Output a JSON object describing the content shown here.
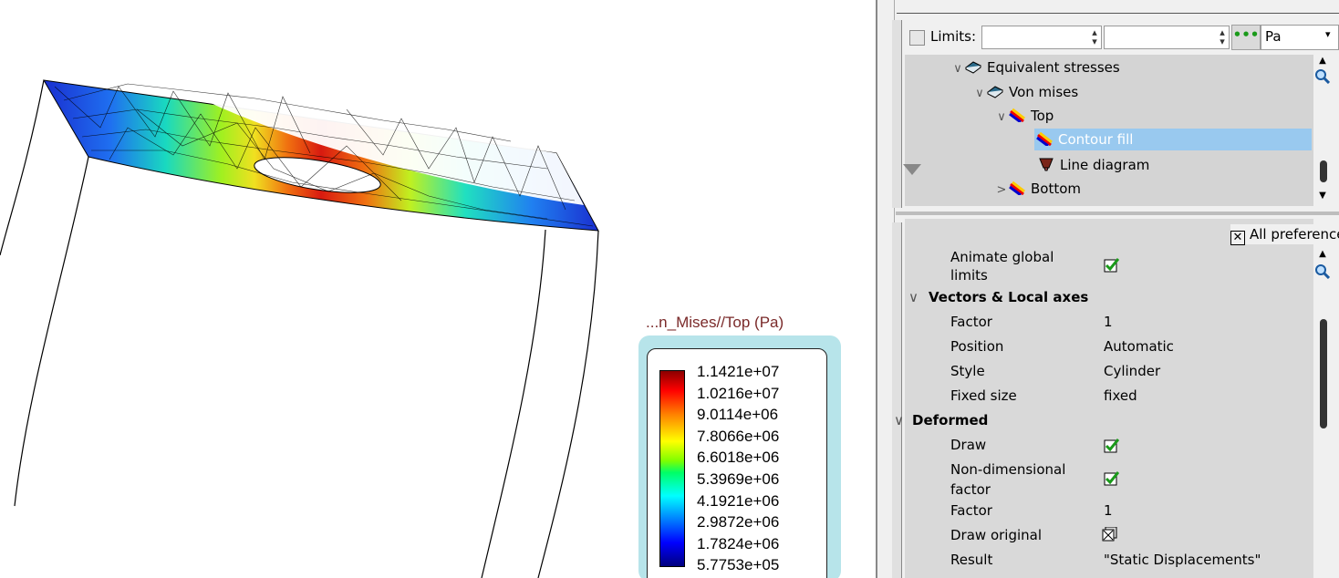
{
  "legend": {
    "title": "...n_Mises//Top  (Pa)",
    "values": [
      "1.1421e+07",
      "1.0216e+07",
      "9.0114e+06",
      "7.8066e+06",
      "6.6018e+06",
      "5.3969e+06",
      "4.1921e+06",
      "2.9872e+06",
      "1.7824e+06",
      "5.7753e+05"
    ],
    "colormap": [
      "#00007f",
      "#0000ff",
      "#0080ff",
      "#00ffff",
      "#00ff66",
      "#7fff00",
      "#ffff00",
      "#ff7f00",
      "#ff0000",
      "#8b0000"
    ]
  },
  "limits": {
    "label": "Limits:",
    "min": "",
    "max": "",
    "unit": "Pa",
    "dots_icon": "•••"
  },
  "tree": {
    "items": [
      {
        "label": "Equivalent stresses",
        "icon": "book-icon",
        "chevron": "∨"
      },
      {
        "label": "Von mises",
        "icon": "book-icon",
        "chevron": "∨"
      },
      {
        "label": "Top",
        "icon": "rainbow-icon",
        "chevron": "∨"
      },
      {
        "label": "Contour fill",
        "icon": "rainbow-icon",
        "chevron": ""
      },
      {
        "label": "Line diagram",
        "icon": "line-diagram-icon",
        "chevron": ""
      },
      {
        "label": "Bottom",
        "icon": "rainbow-icon",
        "chevron": ">"
      }
    ]
  },
  "preferences": {
    "all_preferences_label": "All preferences",
    "rows": [
      {
        "name": "Animate global limits",
        "type": "check",
        "checked": true
      },
      {
        "section": "Vectors & Local axes"
      },
      {
        "name": "Factor",
        "value": "1"
      },
      {
        "name": "Position",
        "value": "Automatic"
      },
      {
        "name": "Style",
        "value": "Cylinder"
      },
      {
        "name": "Fixed size",
        "value": "fixed"
      },
      {
        "section": "Deformed"
      },
      {
        "name": "Draw",
        "type": "check",
        "checked": true
      },
      {
        "name": "Non-dimensional factor",
        "type": "check",
        "checked": true
      },
      {
        "name": "Factor",
        "value": "1"
      },
      {
        "name": "Draw original",
        "type": "check-x",
        "checked": false
      },
      {
        "name": "Result",
        "value": "\"Static Displacements\""
      }
    ]
  },
  "colors": {
    "accent_selected": "#99c9ef",
    "check_green": "#1a9a1a",
    "legend_frame": "#b7e4ea"
  }
}
